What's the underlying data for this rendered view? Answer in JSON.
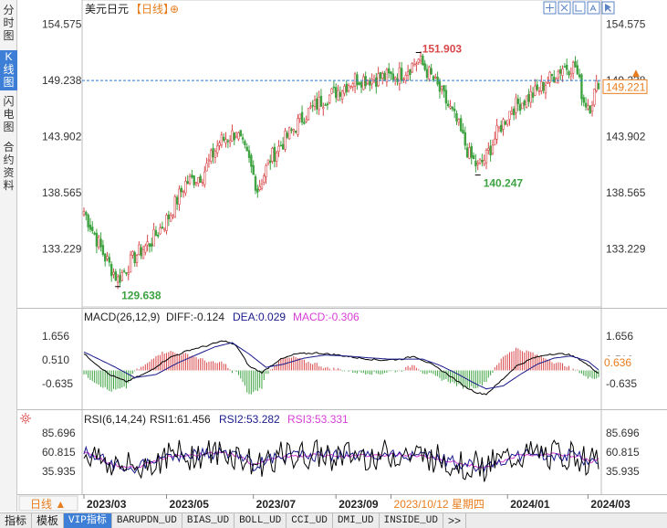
{
  "side_tabs": [
    "分时图",
    "K线图",
    "闪电图",
    "合约资料"
  ],
  "side_active": 1,
  "header": {
    "instrument": "美元日元",
    "period": "【日线】",
    "add_icon": "⊕"
  },
  "toolbar_icons": [
    "crosshair-icon",
    "expand-icon",
    "bar-style-icon",
    "mode-icon",
    "pointer-icon"
  ],
  "price_axis": {
    "ticks": [
      "154.575",
      "149.238",
      "143.902",
      "138.565",
      "133.229"
    ],
    "tick_values": [
      154.575,
      149.238,
      143.902,
      138.565,
      133.229
    ],
    "range": [
      128.4,
      156.2
    ]
  },
  "colors": {
    "up": "#d9474a",
    "down": "#3da341",
    "price_line": "#2a7ad6",
    "highlight": "#e87d1e",
    "macd_diff": "#000000",
    "macd_dea": "#1a1a8c",
    "macd_bar": "#d83ed6",
    "rsi1": "#000000",
    "rsi2": "#1a1a8c",
    "rsi3": "#d83ed6"
  },
  "annotations": {
    "high": "151.903",
    "high_value": 151.903,
    "low": "129.638",
    "low_value": 129.638,
    "mid_low": "140.247",
    "mid_low_value": 140.247
  },
  "current_price": {
    "label": "149.221",
    "value": 149.221,
    "ref_value": 149.238
  },
  "macd": {
    "title": "MACD(26,12,9)",
    "diff_label": "DIFF:-0.124",
    "dea_label": "DEA:0.029",
    "macd_label": "MACD:-0.306",
    "ticks": [
      "1.656",
      "0.510",
      "-0.635"
    ],
    "tick_values": [
      1.656,
      0.51,
      -0.635
    ],
    "current_label": "0.636",
    "range": [
      -1.8,
      2.2
    ]
  },
  "rsi": {
    "title": "RSI(6,14,24)",
    "rsi1_label": "RSI1:61.456",
    "rsi2_label": "RSI2:53.282",
    "rsi3_label": "RSI3:53.331",
    "ticks": [
      "85.696",
      "60.815",
      "35.935"
    ],
    "tick_values": [
      85.696,
      60.815,
      35.935
    ],
    "range": [
      10,
      95
    ]
  },
  "time_axis": {
    "period_button": "日线 ▲",
    "labels": [
      "2023/03",
      "2023/05",
      "2023/07",
      "2023/09",
      "2023/10/12 星期四",
      "2024/01",
      "2024/03"
    ],
    "label_index": [
      0,
      39,
      80,
      119,
      145,
      200,
      238
    ],
    "highlight_index": 4
  },
  "bottom_tabs": [
    "指标",
    "模板",
    "VIP指标",
    "BARUPDN_UD",
    "BIAS_UD",
    "BOLL_UD",
    "CCI_UD",
    "DMI_UD",
    "INSIDE_UD",
    ">>"
  ],
  "bottom_active": 2,
  "chart_data": {
    "type": "candlestick",
    "title": "美元日元 【日线】",
    "ylim": [
      128.4,
      156.2
    ],
    "close_keypoints": [
      [
        0,
        136.8
      ],
      [
        10,
        132.4
      ],
      [
        16,
        130.3
      ],
      [
        24,
        132.5
      ],
      [
        32,
        134.0
      ],
      [
        40,
        136.3
      ],
      [
        48,
        139.5
      ],
      [
        56,
        140.3
      ],
      [
        64,
        143.4
      ],
      [
        72,
        144.3
      ],
      [
        78,
        141.5
      ],
      [
        82,
        138.9
      ],
      [
        88,
        141.8
      ],
      [
        96,
        143.9
      ],
      [
        104,
        145.9
      ],
      [
        112,
        147.3
      ],
      [
        120,
        148.3
      ],
      [
        128,
        149.4
      ],
      [
        136,
        149.4
      ],
      [
        144,
        149.6
      ],
      [
        150,
        149.9
      ],
      [
        158,
        151.2
      ],
      [
        164,
        149.6
      ],
      [
        170,
        147.6
      ],
      [
        176,
        145.3
      ],
      [
        182,
        142.1
      ],
      [
        186,
        141.0
      ],
      [
        190,
        142.0
      ],
      [
        196,
        144.6
      ],
      [
        202,
        146.6
      ],
      [
        208,
        147.4
      ],
      [
        214,
        148.2
      ],
      [
        220,
        149.4
      ],
      [
        226,
        150.5
      ],
      [
        232,
        150.6
      ],
      [
        236,
        147.3
      ],
      [
        239,
        146.9
      ],
      [
        243,
        149.2
      ]
    ],
    "price_line": 149.238,
    "macd_keypoints": {
      "diff": [
        [
          0,
          0.8
        ],
        [
          12,
          -0.2
        ],
        [
          20,
          -0.55
        ],
        [
          30,
          -0.1
        ],
        [
          40,
          0.6
        ],
        [
          50,
          1.0
        ],
        [
          58,
          1.2
        ],
        [
          66,
          1.45
        ],
        [
          72,
          1.2
        ],
        [
          78,
          0.2
        ],
        [
          84,
          -0.1
        ],
        [
          92,
          0.5
        ],
        [
          100,
          0.8
        ],
        [
          110,
          0.85
        ],
        [
          120,
          0.75
        ],
        [
          130,
          0.6
        ],
        [
          140,
          0.5
        ],
        [
          150,
          0.55
        ],
        [
          156,
          0.7
        ],
        [
          164,
          0.3
        ],
        [
          172,
          -0.2
        ],
        [
          180,
          -0.8
        ],
        [
          186,
          -1.1
        ],
        [
          190,
          -1.15
        ],
        [
          196,
          -0.6
        ],
        [
          204,
          0.2
        ],
        [
          212,
          0.6
        ],
        [
          220,
          0.8
        ],
        [
          228,
          0.8
        ],
        [
          234,
          0.55
        ],
        [
          240,
          0.1
        ],
        [
          243,
          -0.124
        ]
      ],
      "dea": [
        [
          0,
          0.9
        ],
        [
          14,
          0.2
        ],
        [
          24,
          -0.35
        ],
        [
          34,
          -0.2
        ],
        [
          44,
          0.35
        ],
        [
          54,
          0.8
        ],
        [
          62,
          1.15
        ],
        [
          70,
          1.35
        ],
        [
          78,
          0.8
        ],
        [
          86,
          0.15
        ],
        [
          94,
          0.3
        ],
        [
          104,
          0.6
        ],
        [
          114,
          0.75
        ],
        [
          124,
          0.7
        ],
        [
          134,
          0.62
        ],
        [
          144,
          0.55
        ],
        [
          152,
          0.55
        ],
        [
          160,
          0.55
        ],
        [
          168,
          0.25
        ],
        [
          176,
          -0.15
        ],
        [
          184,
          -0.6
        ],
        [
          190,
          -0.9
        ],
        [
          198,
          -0.75
        ],
        [
          206,
          -0.2
        ],
        [
          214,
          0.3
        ],
        [
          222,
          0.6
        ],
        [
          230,
          0.7
        ],
        [
          238,
          0.45
        ],
        [
          243,
          0.029
        ]
      ]
    },
    "rsi_keypoints": {
      "rsi3": [
        [
          0,
          62
        ],
        [
          14,
          44
        ],
        [
          24,
          40
        ],
        [
          40,
          56
        ],
        [
          56,
          58
        ],
        [
          66,
          60
        ],
        [
          74,
          55
        ],
        [
          80,
          44
        ],
        [
          90,
          54
        ],
        [
          110,
          57
        ],
        [
          130,
          56
        ],
        [
          150,
          58
        ],
        [
          166,
          54
        ],
        [
          180,
          44
        ],
        [
          190,
          42
        ],
        [
          204,
          56
        ],
        [
          220,
          58
        ],
        [
          232,
          56
        ],
        [
          240,
          48
        ],
        [
          243,
          53.3
        ]
      ]
    }
  }
}
